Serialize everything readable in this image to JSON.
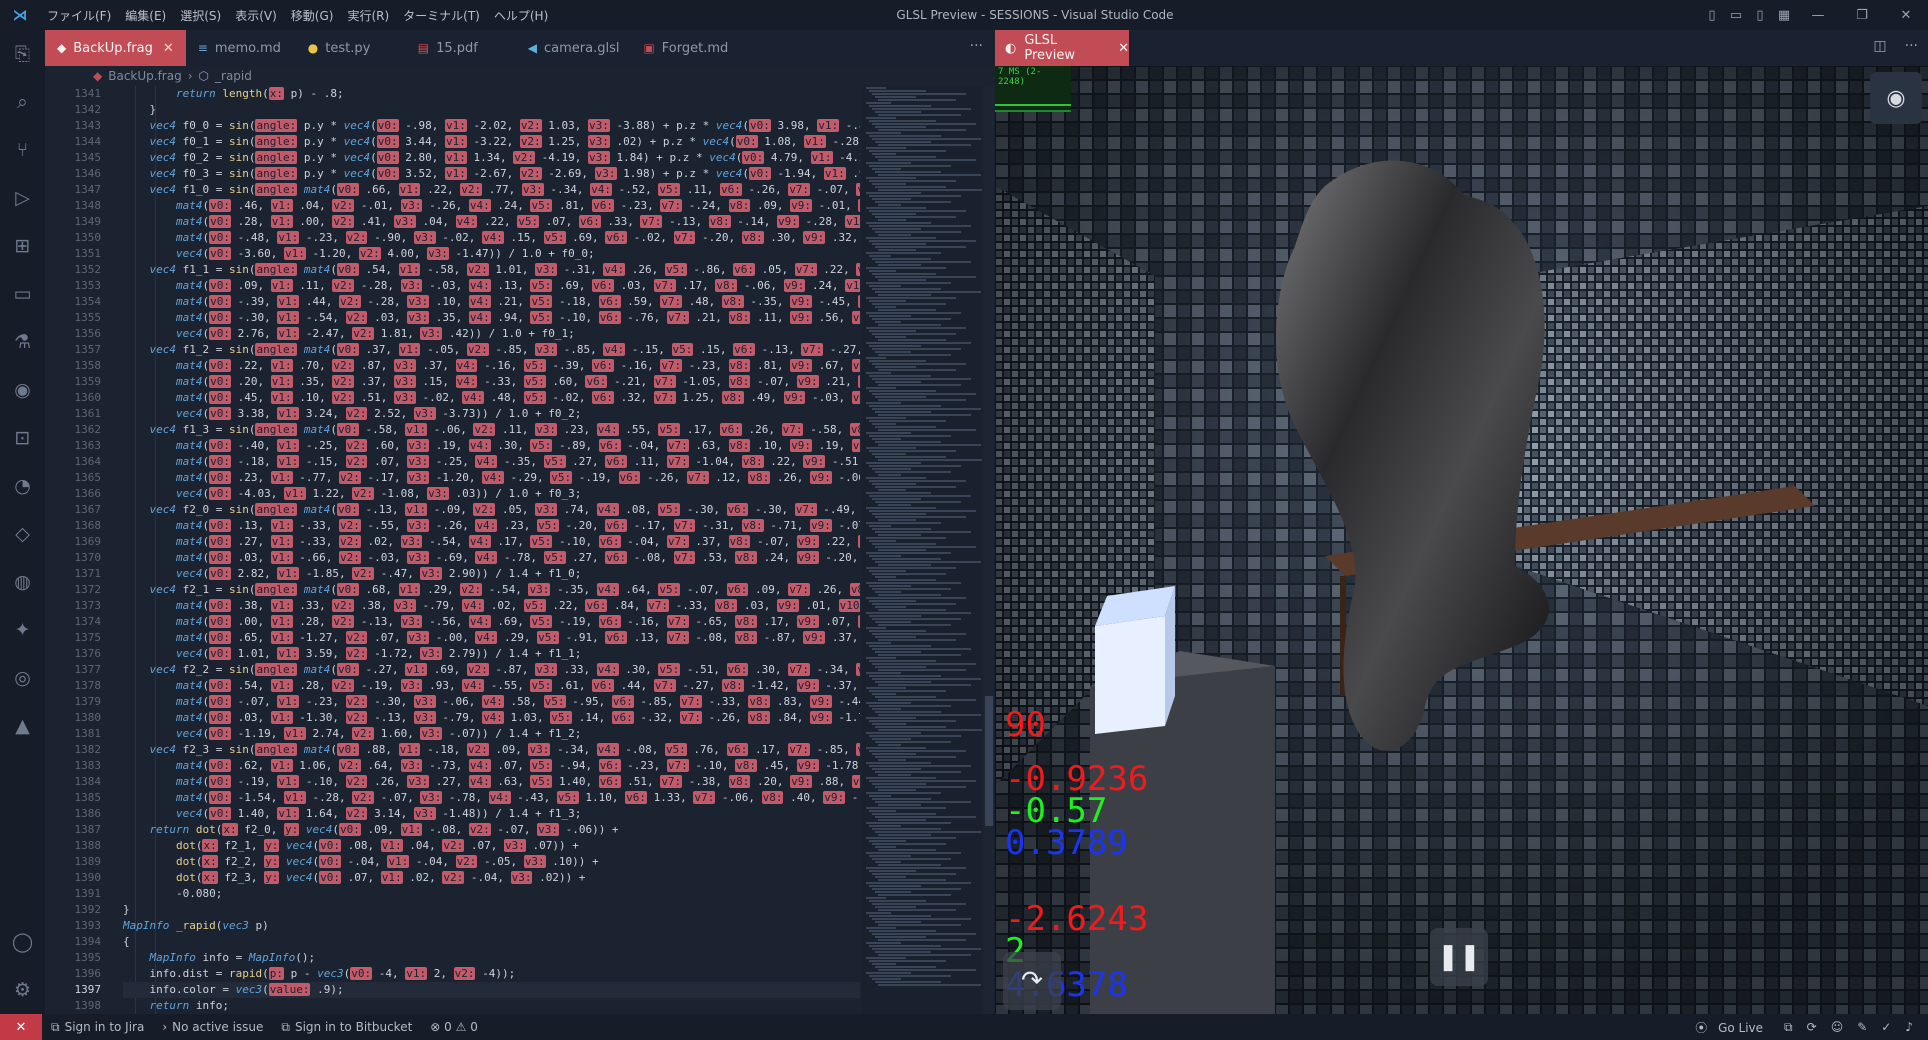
{
  "window": {
    "title": "GLSL Preview - SESSIONS - Visual Studio Code",
    "menu": [
      "ファイル(F)",
      "編集(E)",
      "選択(S)",
      "表示(V)",
      "移動(G)",
      "実行(R)",
      "ターミナル(T)",
      "ヘルプ(H)"
    ]
  },
  "tabs": [
    {
      "label": "BackUp.frag",
      "icon": "frag-file-icon",
      "active": true
    },
    {
      "label": "memo.md",
      "icon": "markdown-file-icon"
    },
    {
      "label": "test.py",
      "icon": "python-file-icon"
    },
    {
      "label": "15.pdf",
      "icon": "pdf-file-icon"
    },
    {
      "label": "camera.glsl",
      "icon": "glsl-file-icon"
    },
    {
      "label": "Forget.md",
      "icon": "markdown-file-icon"
    }
  ],
  "breadcrumb": {
    "file": "BackUp.frag",
    "symbol": "_rapid"
  },
  "editor": {
    "line_numbers": [
      "1341",
      "1342",
      "1343",
      "1344",
      "1345",
      "1346",
      "1347",
      "1348",
      "1349",
      "1350",
      "1351",
      "1352",
      "1353",
      "1354",
      "1355",
      "1356",
      "1357",
      "1358",
      "1359",
      "1360",
      "1361",
      "1362",
      "1363",
      "1364",
      "1365",
      "1366",
      "1367",
      "1368",
      "1369",
      "1370",
      "1371",
      "1372",
      "1373",
      "1374",
      "1375",
      "1376",
      "1377",
      "1378",
      "1379",
      "1380",
      "1381",
      "1382",
      "1383",
      "1384",
      "1385",
      "1386",
      "1387",
      "1388",
      "1389",
      "1390",
      "1391",
      "1392",
      "1393",
      "1394",
      "1395",
      "1396",
      "1397",
      "1398"
    ],
    "current_line": "1397",
    "lines": [
      "        return length(x: p) - .8;",
      "    }",
      "    vec4 f0_0 = sin(angle: p.y * vec4(v0: -.98, v1: -2.02, v2: 1.03, v3: -3.88) + p.z * vec4(v0: 3.98, v1: -.87, v",
      "    vec4 f0_1 = sin(angle: p.y * vec4(v0: 3.44, v1: -3.22, v2: 1.25, v3: .02) + p.z * vec4(v0: 1.08, v1: -.28, v2",
      "    vec4 f0_2 = sin(angle: p.y * vec4(v0: 2.80, v1: 1.34, v2: -4.19, v3: 1.84) + p.z * vec4(v0: 4.79, v1: -4.23, v",
      "    vec4 f0_3 = sin(angle: p.y * vec4(v0: 3.52, v1: -2.67, v2: -2.69, v3: 1.98) + p.z * vec4(v0: -1.94, v1: .94, v",
      "    vec4 f1_0 = sin(angle: mat4(v0: .66, v1: .22, v2: .77, v3: -.34, v4: -.52, v5: .11, v6: -.26, v7: -.07, v8: .47",
      "        mat4(v0: .46, v1: .04, v2: -.01, v3: -.26, v4: .24, v5: .81, v6: -.23, v7: -.24, v8: .09, v9: -.01, v10: .08",
      "        mat4(v0: .28, v1: .00, v2: .41, v3: .04, v4: .22, v5: .07, v6: .33, v7: -.13, v8: -.14, v9: -.28, v10: -.04,",
      "        mat4(v0: -.48, v1: -.23, v2: -.90, v3: -.02, v4: .15, v5: .69, v6: -.02, v7: -.20, v8: .30, v9: .32, v10: -",
      "        vec4(v0: -3.60, v1: -1.20, v2: 4.00, v3: -1.47)) / 1.0 + f0_0;",
      "    vec4 f1_1 = sin(angle: mat4(v0: .54, v1: -.58, v2: 1.01, v3: -.31, v4: .26, v5: -.86, v6: .05, v7: .22, v8: -.3",
      "        mat4(v0: .09, v1: .11, v2: -.28, v3: -.03, v4: .13, v5: .69, v6: .03, v7: .17, v8: -.06, v9: .24, v10: .14,",
      "        mat4(v0: -.39, v1: .44, v2: -.28, v3: .10, v4: .21, v5: -.18, v6: .59, v7: .48, v8: -.35, v9: -.45, v10: -.2",
      "        mat4(v0: -.30, v1: -.54, v2: .03, v3: .35, v4: .94, v5: -.10, v6: -.76, v7: .21, v8: .11, v9: .56, v10: -.22",
      "        vec4(v0: 2.76, v1: -2.47, v2: 1.81, v3: .42)) / 1.0 + f0_1;",
      "    vec4 f1_2 = sin(angle: mat4(v0: .37, v1: -.05, v2: -.85, v3: -.85, v4: -.15, v5: .15, v6: -.13, v7: -.27, v8: .",
      "        mat4(v0: .22, v1: .70, v2: .87, v3: .37, v4: -.16, v5: -.39, v6: -.16, v7: -.23, v8: .81, v9: .67, v10: .65,",
      "        mat4(v0: .20, v1: .35, v2: .37, v3: .15, v4: -.33, v5: .60, v6: -.21, v7: -1.05, v8: -.07, v9: .21, v10: .16",
      "        mat4(v0: .45, v1: .10, v2: .51, v3: -.02, v4: .48, v5: -.02, v6: .32, v7: 1.25, v8: .49, v9: -.03, v10: .07,",
      "        vec4(v0: 3.38, v1: 3.24, v2: 2.52, v3: -3.73)) / 1.0 + f0_2;",
      "    vec4 f1_3 = sin(angle: mat4(v0: -.58, v1: -.06, v2: .11, v3: .23, v4: .55, v5: .17, v6: .26, v7: -.58, v8: -.34",
      "        mat4(v0: -.40, v1: -.25, v2: .60, v3: .19, v4: .30, v5: -.89, v6: -.04, v7: .63, v8: .10, v9: .19, v10: .22,",
      "        mat4(v0: -.18, v1: -.15, v2: .07, v3: -.25, v4: -.35, v5: .27, v6: .11, v7: -1.04, v8: .22, v9: -.51, v10: .6",
      "        mat4(v0: .23, v1: -.77, v2: -.17, v3: -1.20, v4: -.29, v5: -.19, v6: -.26, v7: .12, v8: .26, v9: -.06, v10:",
      "        vec4(v0: -4.03, v1: 1.22, v2: -1.08, v3: .03)) / 1.0 + f0_3;",
      "    vec4 f2_0 = sin(angle: mat4(v0: -.13, v1: -.09, v2: .05, v3: .74, v4: .08, v5: -.30, v6: -.30, v7: -.49, v8: .0",
      "        mat4(v0: .13, v1: -.33, v2: -.55, v3: -.26, v4: .23, v5: -.20, v6: -.17, v7: -.31, v8: -.71, v9: -.07, v10:",
      "        mat4(v0: .27, v1: -.33, v2: .02, v3: -.54, v4: .17, v5: -.10, v6: -.04, v7: .37, v8: -.07, v9: .22, v10: -.1",
      "        mat4(v0: .03, v1: -.66, v2: -.03, v3: -.69, v4: -.78, v5: .27, v6: -.08, v7: .53, v8: .24, v9: -.20, v10: .7",
      "        vec4(v0: 2.82, v1: -1.85, v2: -.47, v3: 2.90)) / 1.4 + f1_0;",
      "    vec4 f2_1 = sin(angle: mat4(v0: .68, v1: .29, v2: -.54, v3: -.35, v4: .64, v5: -.07, v6: .09, v7: .26, v8: -.01",
      "        mat4(v0: .38, v1: .33, v2: .38, v3: -.79, v4: .02, v5: .22, v6: .84, v7: -.33, v8: .03, v9: .01, v10: -.68,",
      "        mat4(v0: .00, v1: .28, v2: -.13, v3: -.56, v4: .69, v5: -.19, v6: -.16, v7: -.65, v8: .17, v9: .07, v10: .11",
      "        mat4(v0: .65, v1: -1.27, v2: .07, v3: -.00, v4: .29, v5: -.91, v6: .13, v7: -.08, v8: -.87, v9: .37, v10: .3",
      "        vec4(v0: 1.01, v1: 3.59, v2: -1.72, v3: 2.79)) / 1.4 + f1_1;",
      "    vec4 f2_2 = sin(angle: mat4(v0: -.27, v1: .69, v2: -.87, v3: .33, v4: .30, v5: -.51, v6: .30, v7: -.34, v8: -.7",
      "        mat4(v0: .54, v1: .28, v2: -.19, v3: .93, v4: -.55, v5: .61, v6: .44, v7: -.27, v8: -1.42, v9: -.37, v10: -.",
      "        mat4(v0: -.07, v1: -.23, v2: -.30, v3: -.06, v4: .58, v5: -.95, v6: -.85, v7: -.33, v8: .83, v9: -.44, v10:",
      "        mat4(v0: .03, v1: -1.30, v2: -.13, v3: -.79, v4: 1.03, v5: .14, v6: -.32, v7: -.26, v8: .84, v9: -1.78, v10",
      "        vec4(v0: -1.19, v1: 2.74, v2: 1.60, v3: -.07)) / 1.4 + f1_2;",
      "    vec4 f2_3 = sin(angle: mat4(v0: .88, v1: -.18, v2: .09, v3: -.34, v4: -.08, v5: .76, v6: .17, v7: -.85, v8: -.6",
      "        mat4(v0: .62, v1: 1.06, v2: .64, v3: -.73, v4: .07, v5: -.94, v6: -.23, v7: -.10, v8: .45, v9: -1.78, v10: .",
      "        mat4(v0: -.19, v1: -.10, v2: .26, v3: .27, v4: .63, v5: 1.40, v6: .51, v7: -.38, v8: .20, v9: .88, v10: -.7",
      "        mat4(v0: -1.54, v1: -.28, v2: -.07, v3: -.78, v4: -.43, v5: 1.10, v6: 1.33, v7: -.06, v8: .40, v9: -.52, v1",
      "        vec4(v0: 1.40, v1: 1.64, v2: 3.14, v3: -1.48)) / 1.4 + f1_3;",
      "    return dot(x: f2_0, y: vec4(v0: .09, v1: -.08, v2: -.07, v3: -.06)) +",
      "        dot(x: f2_1, y: vec4(v0: .08, v1: .04, v2: .07, v3: .07)) +",
      "        dot(x: f2_2, y: vec4(v0: -.04, v1: -.04, v2: -.05, v3: .10)) +",
      "        dot(x: f2_3, y: vec4(v0: .07, v1: .02, v2: -.04, v3: .02)) +",
      "        -0.080;",
      "}",
      "MapInfo _rapid(vec3 p)",
      "{",
      "    MapInfo info = MapInfo();",
      "    info.dist = rapid(p: p - vec3(v0: -4, v1: 2, v2: -4));",
      "    info.color = vec3(value: .9);",
      "    return info;"
    ]
  },
  "preview": {
    "tab_label": "GLSL Preview",
    "fps_text": "7 MS (2-2248)",
    "values": [
      {
        "text": "90",
        "color": "red"
      },
      {
        "text": "-0.9236",
        "color": "red"
      },
      {
        "text": "-0.57",
        "color": "green"
      },
      {
        "text": "0.3789",
        "color": "blue"
      },
      {
        "text": "-2.6243",
        "color": "red"
      },
      {
        "text": "2",
        "color": "green"
      },
      {
        "text": "4.6378",
        "color": "blue"
      }
    ],
    "camera_icon": "camera-icon",
    "pause_icon": "pause-icon",
    "redo_icon": "redo-arrow-icon"
  },
  "status": {
    "remote_icon": "remote-icon",
    "items": [
      "Sign in to Jira",
      "No active issue",
      "Sign in to Bitbucket",
      "⊗ 0 ⚠ 0"
    ],
    "right": [
      "Go Live"
    ]
  }
}
